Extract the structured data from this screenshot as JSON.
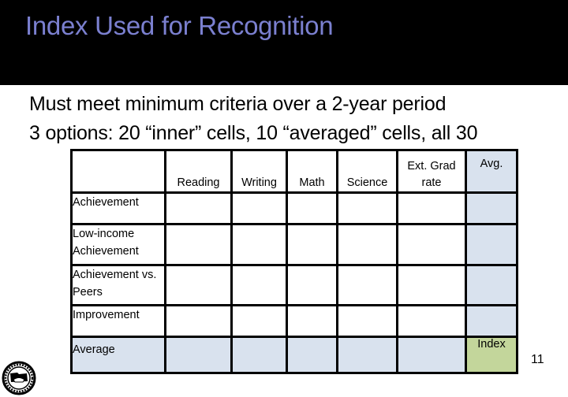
{
  "slide": {
    "title": "Index Used for Recognition",
    "bullets": [
      "Must meet minimum criteria over a 2-year period",
      "3 options: 20 “inner” cells, 10 “averaged” cells, all 30"
    ],
    "page_number": "11",
    "logo": "state-seal-icon"
  },
  "table": {
    "columns": [
      "",
      "Reading",
      "Writing",
      "Math",
      "Science",
      "Ext. Grad rate",
      "Avg."
    ],
    "rows": [
      {
        "label": "Achievement",
        "cells": [
          "",
          "",
          "",
          "",
          "",
          ""
        ]
      },
      {
        "label": "Low-income Achievement",
        "cells": [
          "",
          "",
          "",
          "",
          "",
          ""
        ]
      },
      {
        "label": "Achievement vs. Peers",
        "cells": [
          "",
          "",
          "",
          "",
          "",
          ""
        ]
      },
      {
        "label": "Improvement",
        "cells": [
          "",
          "",
          "",
          "",
          "",
          ""
        ]
      },
      {
        "label": "Average",
        "cells": [
          "",
          "",
          "",
          "",
          "",
          "Index"
        ]
      }
    ]
  },
  "colors": {
    "title": "#7b80d0",
    "header_bg": "#000000",
    "average_fill": "#d9e2ee",
    "index_fill": "#c3d69b"
  }
}
